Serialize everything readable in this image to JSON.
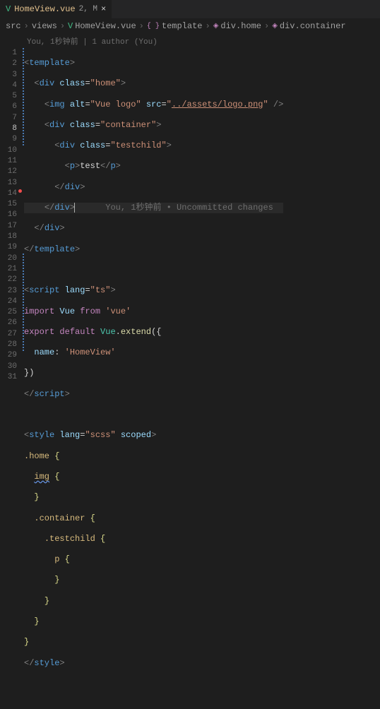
{
  "tab": {
    "filename": "HomeView.vue",
    "statusText": "2, M",
    "closeGlyph": "×",
    "vueGlyph": "V"
  },
  "breadcrumbs": {
    "sepGlyph": "›",
    "items": [
      {
        "label": "src",
        "icon": null
      },
      {
        "label": "views",
        "icon": null
      },
      {
        "label": "HomeView.vue",
        "icon": "vue"
      },
      {
        "label": "template",
        "icon": "braces"
      },
      {
        "label": "div.home",
        "icon": "cube"
      },
      {
        "label": "div.container",
        "icon": "cube"
      }
    ]
  },
  "blame": "You, 1秒钟前 | 1 author (You)",
  "inlineBlame": "You, 1秒钟前 • Uncommitted changes",
  "activeLine": 8,
  "lineNumbers": [
    1,
    2,
    3,
    4,
    5,
    6,
    7,
    8,
    9,
    10,
    11,
    12,
    13,
    14,
    15,
    16,
    17,
    18,
    19,
    20,
    21,
    22,
    23,
    24,
    25,
    26,
    27,
    28,
    29,
    30,
    31
  ],
  "code": {
    "l1": {
      "tag": "template"
    },
    "l2": {
      "tag": "div",
      "attr": "class",
      "val": "home"
    },
    "l3": {
      "tag": "img",
      "a1": "alt",
      "v1": "Vue logo",
      "a2": "src",
      "v2": "../assets/logo.png"
    },
    "l4": {
      "tag": "div",
      "attr": "class",
      "val": "container"
    },
    "l5": {
      "tag": "div",
      "attr": "class",
      "val": "testchild"
    },
    "l6": {
      "tag": "p",
      "txt": "test"
    },
    "l7": {
      "close": "div"
    },
    "l8": {
      "close": "div"
    },
    "l9": {
      "close": "div"
    },
    "l10": {
      "close": "template"
    },
    "l12": {
      "tag": "script",
      "attr": "lang",
      "val": "ts"
    },
    "l13": {
      "kw1": "import",
      "var": "Vue",
      "kw2": "from",
      "str": "'vue'"
    },
    "l14": {
      "kw1": "export",
      "kw2": "default",
      "var": "Vue",
      "fn": "extend",
      "open": "({"
    },
    "l15": {
      "key": "name",
      "val": "'HomeView'"
    },
    "l16": {
      "txt": "})"
    },
    "l17": {
      "close": "script"
    },
    "l19": {
      "tag": "style",
      "a1": "lang",
      "v1": "scss",
      "a2": "scoped"
    },
    "l20": {
      "sel": ".home",
      "brace": "{"
    },
    "l21": {
      "sel": "img",
      "brace": "{"
    },
    "l22": {
      "brace": "}"
    },
    "l23": {
      "sel": ".container",
      "brace": "{"
    },
    "l24": {
      "sel": ".testchild",
      "brace": "{"
    },
    "l25": {
      "sel": "p",
      "brace": "{"
    },
    "l26": {
      "brace": "}"
    },
    "l27": {
      "brace": "}"
    },
    "l28": {
      "brace": "}"
    },
    "l29": {
      "brace": "}"
    },
    "l30": {
      "close": "style"
    }
  }
}
